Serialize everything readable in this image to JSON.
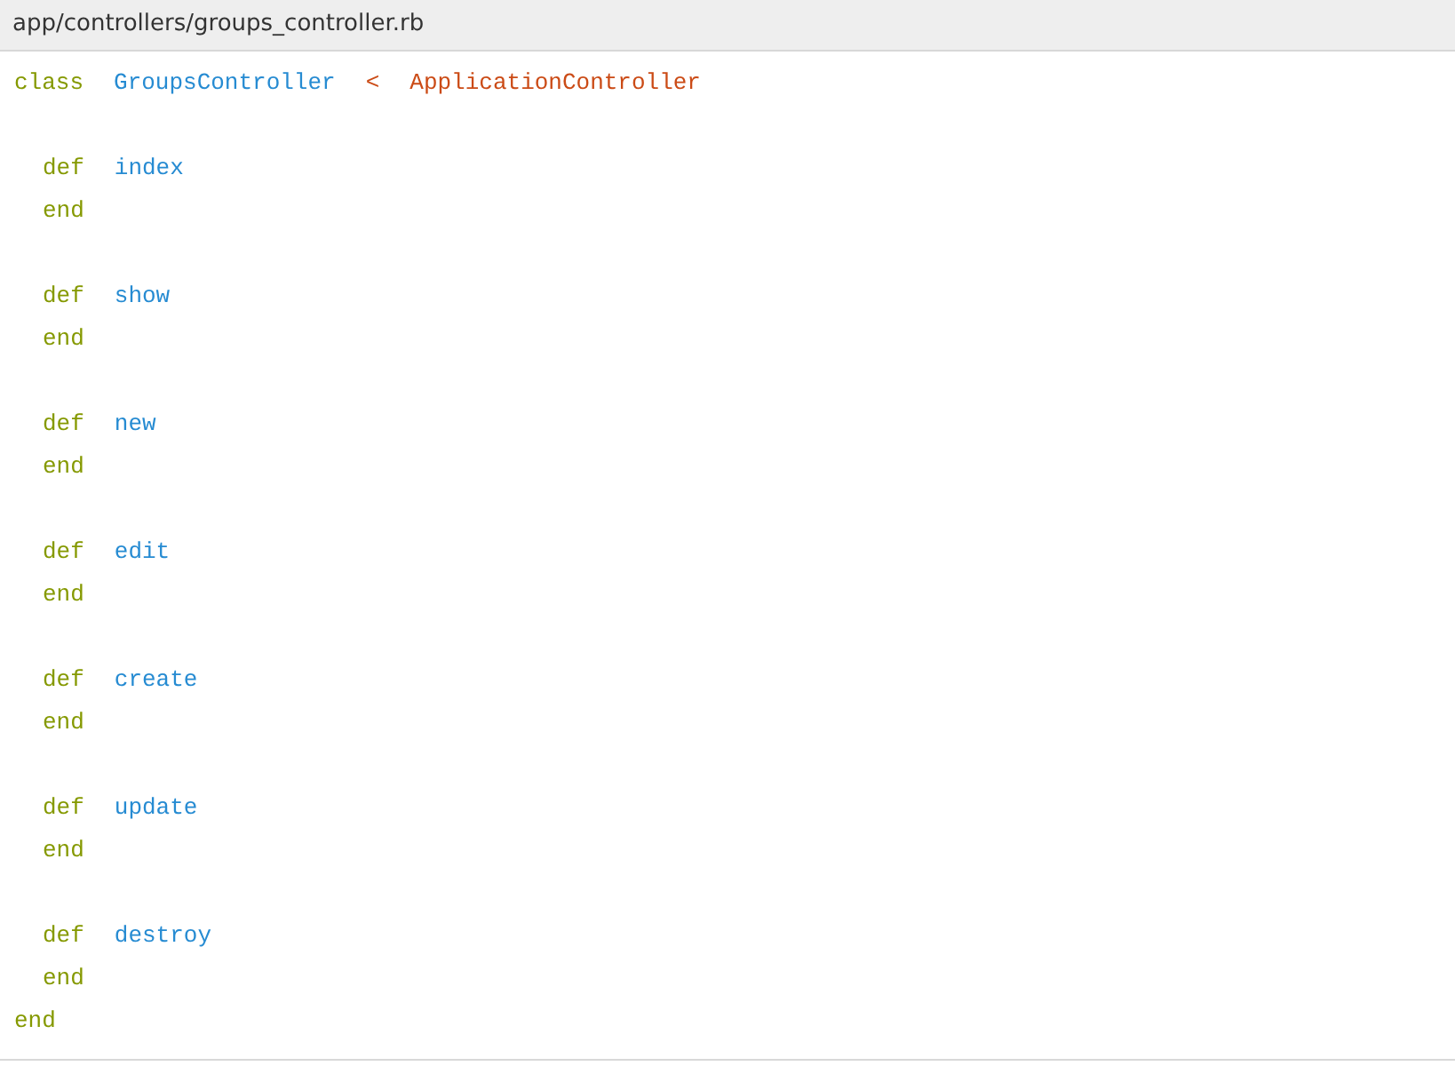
{
  "file_path": "app/controllers/groups_controller.rb",
  "code": {
    "keyword": "class",
    "name": "GroupsController",
    "operator": "<",
    "superclass": "ApplicationController",
    "end": "end",
    "methods": [
      {
        "keyword": "def",
        "name": "index",
        "end": "end"
      },
      {
        "keyword": "def",
        "name": "show",
        "end": "end"
      },
      {
        "keyword": "def",
        "name": "new",
        "end": "end"
      },
      {
        "keyword": "def",
        "name": "edit",
        "end": "end"
      },
      {
        "keyword": "def",
        "name": "create",
        "end": "end"
      },
      {
        "keyword": "def",
        "name": "update",
        "end": "end"
      },
      {
        "keyword": "def",
        "name": "destroy",
        "end": "end"
      }
    ]
  }
}
